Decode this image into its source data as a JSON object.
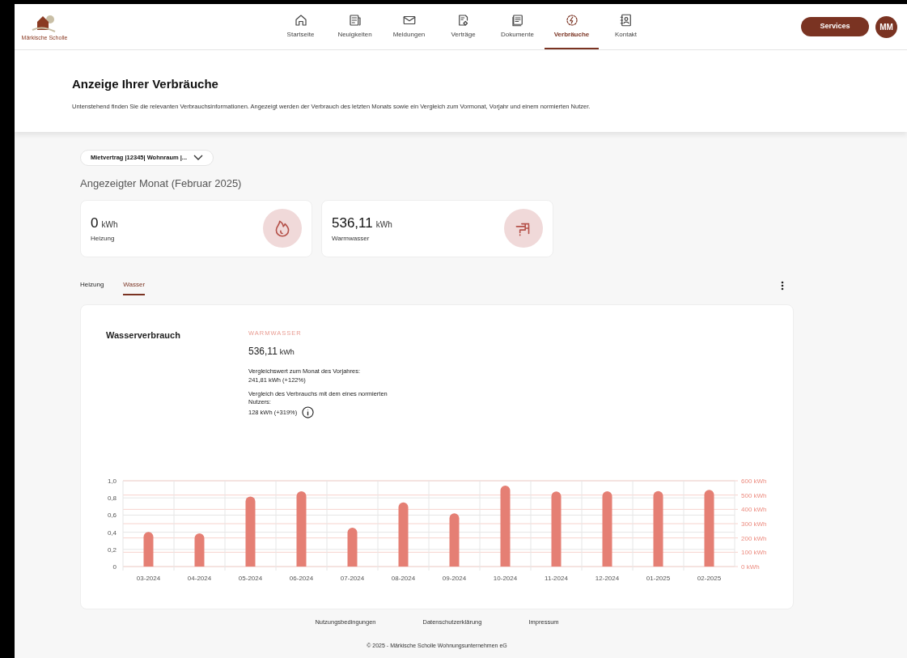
{
  "header": {
    "logo_text": "Märkische Scholle",
    "nav": [
      {
        "label": "Startseite",
        "kind": "home",
        "selected": false
      },
      {
        "label": "Neuigkeiten",
        "kind": "news",
        "selected": false
      },
      {
        "label": "Meldungen",
        "kind": "mail",
        "selected": false
      },
      {
        "label": "Verträge",
        "kind": "contract",
        "selected": false
      },
      {
        "label": "Dokumente",
        "kind": "docs",
        "selected": false
      },
      {
        "label": "Verbräuche",
        "kind": "energy",
        "selected": true
      },
      {
        "label": "Kontakt",
        "kind": "contact",
        "selected": false
      }
    ],
    "services_button": "Services",
    "avatar": "MM"
  },
  "hero": {
    "title": "Anzeige Ihrer Verbräuche",
    "text": "Untenstehend finden Sie die relevanten Verbrauchsinformationen. Angezeigt werden der Verbrauch des letzten Monats sowie ein Vergleich zum Vormonat, Vorjahr und einem normierten Nutzer."
  },
  "contract_select": "Mietvertrag |12345| Wohnraum |...",
  "month_heading": "Angezeigter Monat (Februar 2025)",
  "summary_cards": [
    {
      "value": "0",
      "unit": "kWh",
      "label": "Heizung",
      "kind": "flame"
    },
    {
      "value": "536,11",
      "unit": "kWh",
      "label": "Warmwasser",
      "kind": "tap"
    }
  ],
  "tabs": [
    {
      "label": "Heizung",
      "selected": false
    },
    {
      "label": "Wasser",
      "selected": true
    }
  ],
  "panel": {
    "title": "Wasserverbrauch",
    "category": "WARMWASSER",
    "value": "536,11",
    "unit": "kWh",
    "comparison_year_label": "Vergleichswert zum Monat des Vorjahres:",
    "comparison_year_value": "241,81 kWh (+122%)",
    "comparison_norm_label": "Vergleich des Verbrauchs mit dem eines normierten Nutzers:",
    "comparison_norm_value": "128 kWh (+319%)",
    "left_axis_ticks": [
      "1,0",
      "0,8",
      "0,6",
      "0,4",
      "0,2",
      "0"
    ],
    "chart_data": {
      "type": "bar",
      "categories": [
        "03-2024",
        "04-2024",
        "05-2024",
        "06-2024",
        "07-2024",
        "08-2024",
        "09-2024",
        "10-2024",
        "11-2024",
        "12-2024",
        "01-2025",
        "02-2025"
      ],
      "series": [
        {
          "color": "#e57f74",
          "values": [
            242,
            232,
            490,
            527,
            272,
            449,
            372,
            566,
            525,
            526,
            528,
            536
          ]
        }
      ],
      "ylim": [
        0,
        600
      ],
      "grid": true,
      "yticks": [
        {
          "value": 0,
          "label": "0 kWh"
        },
        {
          "value": 100,
          "label": "100 kWh"
        },
        {
          "value": 200,
          "label": "200 kWh"
        },
        {
          "value": 300,
          "label": "300 kWh"
        },
        {
          "value": 400,
          "label": "400 kWh"
        },
        {
          "value": 500,
          "label": "500 kWh"
        },
        {
          "value": 600,
          "label": "600 kWh"
        }
      ]
    }
  },
  "footer": {
    "links": [
      "Nutzungsbedingungen",
      "Datenschutzerklärung",
      "Impressum"
    ],
    "copyright": "© 2025 - Märkische Scholle Wohnungsunternehmen eG"
  }
}
